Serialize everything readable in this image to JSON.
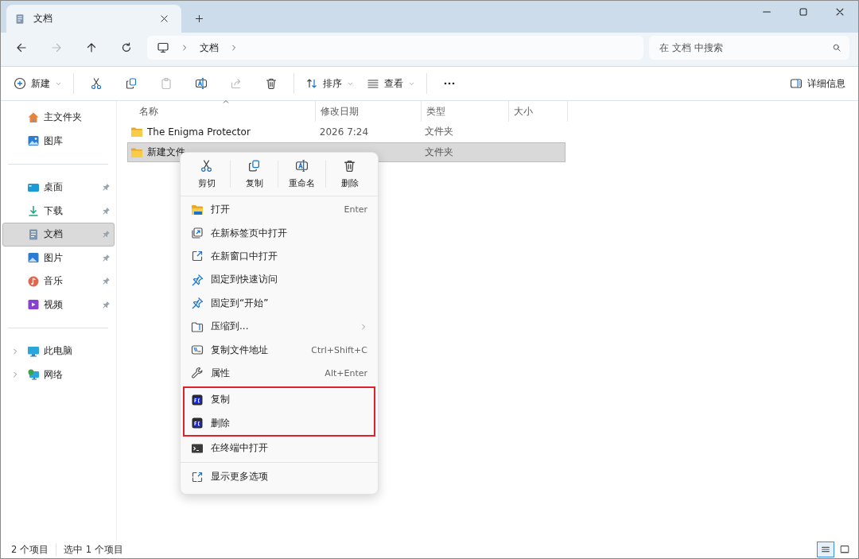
{
  "window": {
    "tab": {
      "title": "文档"
    }
  },
  "nav": {
    "breadcrumb": [
      "文档"
    ],
    "search": {
      "placeholder": "在 文档 中搜索"
    }
  },
  "toolbar": {
    "new_label": "新建",
    "buttons": [
      {
        "kind": "cut",
        "disabled": false
      },
      {
        "kind": "copy",
        "disabled": false
      },
      {
        "kind": "paste",
        "disabled": true
      },
      {
        "kind": "rename",
        "disabled": false
      },
      {
        "kind": "share",
        "disabled": true
      },
      {
        "kind": "delete",
        "disabled": false
      }
    ],
    "sort_label": "排序",
    "view_label": "查看",
    "details_label": "详细信息"
  },
  "sidebar": {
    "groups": [
      [
        {
          "kind": "home",
          "label": "主文件夹",
          "pinned": false,
          "selected": false,
          "expandable": false
        },
        {
          "kind": "gallery",
          "label": "图库",
          "pinned": false,
          "selected": false,
          "expandable": false
        }
      ],
      [
        {
          "kind": "desktop",
          "label": "桌面",
          "pinned": true,
          "selected": false,
          "expandable": false
        },
        {
          "kind": "download",
          "label": "下载",
          "pinned": true,
          "selected": false,
          "expandable": false
        },
        {
          "kind": "document",
          "label": "文档",
          "pinned": true,
          "selected": true,
          "expandable": false
        },
        {
          "kind": "pictures",
          "label": "图片",
          "pinned": true,
          "selected": false,
          "expandable": false
        },
        {
          "kind": "music",
          "label": "音乐",
          "pinned": true,
          "selected": false,
          "expandable": false
        },
        {
          "kind": "video",
          "label": "视频",
          "pinned": true,
          "selected": false,
          "expandable": false
        }
      ],
      [
        {
          "kind": "pc",
          "label": "此电脑",
          "pinned": false,
          "selected": false,
          "expandable": true
        },
        {
          "kind": "network",
          "label": "网络",
          "pinned": false,
          "selected": false,
          "expandable": true
        }
      ]
    ]
  },
  "table": {
    "columns": [
      "名称",
      "修改日期",
      "类型",
      "大小"
    ],
    "rows": [
      {
        "name": "The Enigma Protector",
        "modified": "2026 7:24",
        "type": "文件夹",
        "selected": false
      },
      {
        "name": "新建文件",
        "type": "文件夹",
        "selected": true
      }
    ]
  },
  "context_menu": {
    "actions": [
      {
        "kind": "cut",
        "label": "剪切"
      },
      {
        "kind": "copy",
        "label": "复制"
      },
      {
        "kind": "rename",
        "label": "重命名"
      },
      {
        "kind": "delete",
        "label": "删除"
      }
    ],
    "sections": [
      {
        "kind": "plain",
        "items": [
          {
            "kind": "open",
            "label": "打开",
            "shortcut": "Enter",
            "submenu": false
          },
          {
            "kind": "newtab",
            "label": "在新标签页中打开",
            "submenu": false
          },
          {
            "kind": "newwindow",
            "label": "在新窗口中打开",
            "submenu": false
          },
          {
            "kind": "pin",
            "label": "固定到快速访问",
            "submenu": false
          },
          {
            "kind": "pin",
            "label": "固定到“开始”",
            "submenu": false
          },
          {
            "kind": "zip",
            "label": "压缩到...",
            "submenu": true
          },
          {
            "kind": "copypath",
            "label": "复制文件地址",
            "shortcut": "Ctrl+Shift+C",
            "submenu": false
          },
          {
            "kind": "wrench",
            "label": "属性",
            "shortcut": "Alt+Enter",
            "submenu": false
          }
        ]
      },
      {
        "kind": "highlighted",
        "items": [
          {
            "kind": "fc",
            "label": "复制",
            "submenu": false
          },
          {
            "kind": "fc",
            "label": "删除",
            "submenu": false
          }
        ]
      },
      {
        "kind": "plain",
        "items": [
          {
            "kind": "terminal",
            "label": "在终端中打开",
            "submenu": false
          }
        ]
      },
      {
        "kind": "footer",
        "items": [
          {
            "kind": "more",
            "label": "显示更多选项",
            "submenu": false
          }
        ]
      }
    ]
  },
  "status_bar": {
    "count": "2 个项目",
    "selection": "选中 1 个项目",
    "views": [
      {
        "kind": "details",
        "selected": true
      },
      {
        "kind": "tiles",
        "selected": false
      }
    ]
  }
}
